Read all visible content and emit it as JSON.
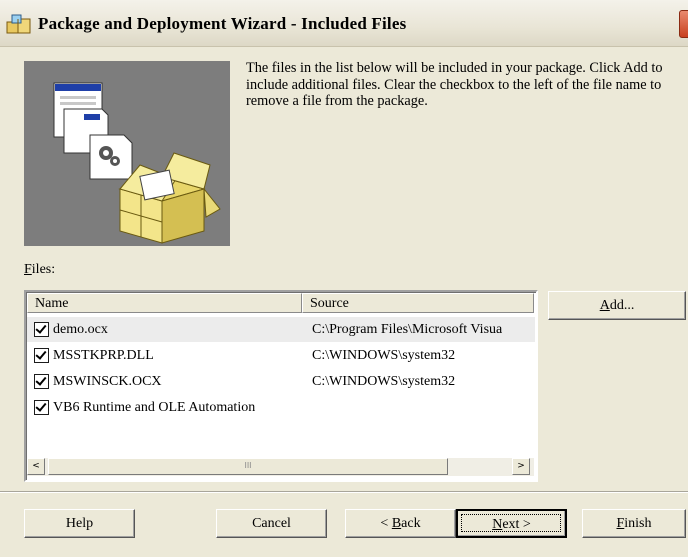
{
  "window": {
    "title": "Package and Deployment Wizard - Included Files"
  },
  "intro_text": "The files in the list below will be included in your package. Click Add to include additional files. Clear the checkbox to the left of the file name to remove a file from the package.",
  "files_label": {
    "hotkey": "F",
    "rest": "iles:"
  },
  "list": {
    "columns": [
      "Name",
      "Source"
    ],
    "rows": [
      {
        "name": "demo.ocx",
        "source": "C:\\Program Files\\Microsoft Visua",
        "checked": true,
        "selected": true
      },
      {
        "name": "MSSTKPRP.DLL",
        "source": "C:\\WINDOWS\\system32",
        "checked": true,
        "selected": false
      },
      {
        "name": "MSWINSCK.OCX",
        "source": "C:\\WINDOWS\\system32",
        "checked": true,
        "selected": false
      },
      {
        "name": "VB6 Runtime and OLE Automation",
        "source": "",
        "checked": true,
        "selected": false
      }
    ]
  },
  "scroll": {
    "left_arrow": "<",
    "right_arrow": ">",
    "thumb_grip": "III"
  },
  "buttons": {
    "add": {
      "hotkey": "A",
      "rest": "dd..."
    },
    "help": {
      "label": "Help"
    },
    "cancel": {
      "label": "Cancel"
    },
    "back": {
      "prefix": "< ",
      "hotkey": "B",
      "rest": "ack"
    },
    "next": {
      "hotkey": "N",
      "rest": "ext >"
    },
    "finish": {
      "hotkey": "F",
      "rest": "inish"
    }
  }
}
